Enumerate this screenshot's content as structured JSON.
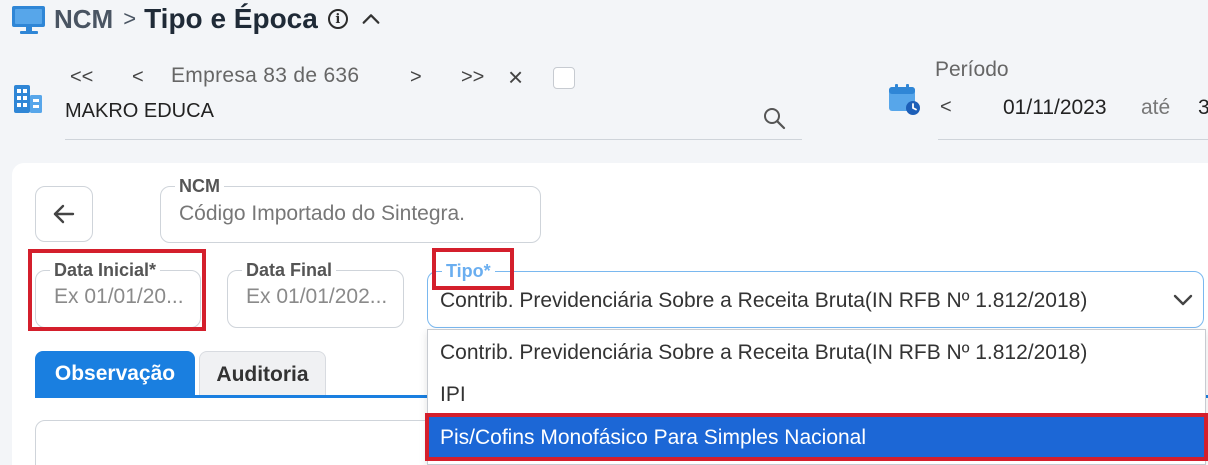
{
  "header": {
    "root": "NCM",
    "separator": ">",
    "current": "Tipo e Época",
    "info_glyph": "i",
    "icons": [
      "monitor-icon",
      "info-icon",
      "chevron-up-icon"
    ]
  },
  "empresa": {
    "first": "<<",
    "prev": "<",
    "label": "Empresa 83 de 636",
    "next": ">",
    "last": ">>",
    "clear": "×",
    "company_name": "MAKRO EDUCA",
    "icons": [
      "building-icon",
      "search-icon"
    ]
  },
  "periodo": {
    "label": "Período",
    "prev": "<",
    "start": "01/11/2023",
    "separator": "até",
    "end": "3",
    "icons": [
      "calendar-icon"
    ]
  },
  "form": {
    "back_icon": "arrow-left-icon",
    "ncm": {
      "legend": "NCM",
      "value": "Código Importado do Sintegra."
    },
    "data_inicial": {
      "legend": "Data Inicial*",
      "placeholder": "Ex 01/01/20..."
    },
    "data_final": {
      "legend": "Data Final",
      "placeholder": "Ex 01/01/202..."
    },
    "tipo": {
      "legend": "Tipo*",
      "value": "Contrib. Previdenciária Sobre a Receita Bruta(IN RFB Nº 1.812/2018)",
      "options": [
        "Contrib. Previdenciária Sobre a Receita Bruta(IN RFB Nº 1.812/2018)",
        "IPI",
        "Pis/Cofins Monofásico Para Simples Nacional"
      ],
      "highlighted_option": 2
    }
  },
  "tabs": [
    {
      "label": "Observação",
      "active": true
    },
    {
      "label": "Auditoria",
      "active": false
    }
  ],
  "colors": {
    "accent": "#1a7fe0",
    "highlight": "#1c67d6",
    "annotation_red": "#d41f2c",
    "focus_border": "#7ab8ef"
  }
}
